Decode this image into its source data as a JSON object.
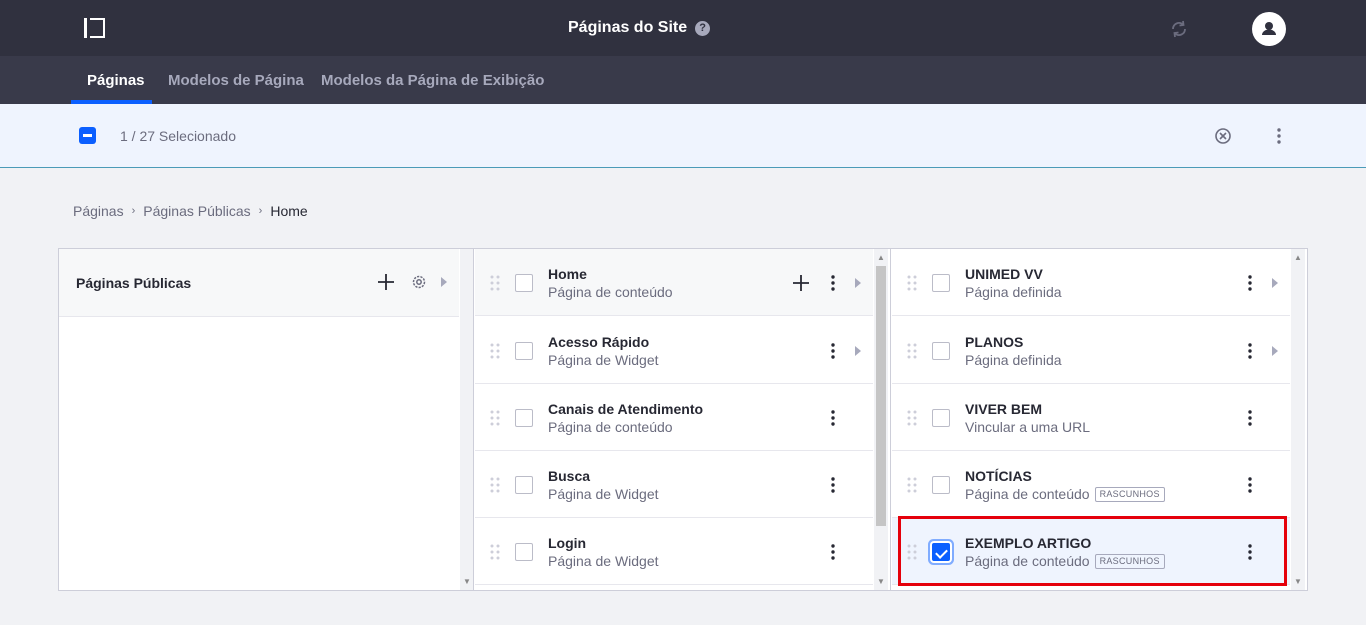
{
  "header": {
    "title": "Páginas do Site",
    "help_icon": "?"
  },
  "tabs": [
    {
      "label": "Páginas",
      "active": true
    },
    {
      "label": "Modelos de Página",
      "active": false
    },
    {
      "label": "Modelos da Página de Exibição",
      "active": false
    }
  ],
  "management_bar": {
    "selection_text": "1 / 27 Selecionado"
  },
  "breadcrumb": [
    "Páginas",
    "Páginas Públicas",
    "Home"
  ],
  "column1": {
    "title": "Páginas Públicas"
  },
  "column2": {
    "rows": [
      {
        "title": "Home",
        "subtitle": "Página de conteúdo"
      },
      {
        "title": "Acesso Rápido",
        "subtitle": "Página de Widget"
      },
      {
        "title": "Canais de Atendimento",
        "subtitle": "Página de conteúdo"
      },
      {
        "title": "Busca",
        "subtitle": "Página de Widget"
      },
      {
        "title": "Login",
        "subtitle": "Página de Widget"
      }
    ]
  },
  "column3": {
    "rows": [
      {
        "title": "UNIMED VV",
        "subtitle": "Página definida"
      },
      {
        "title": "PLANOS",
        "subtitle": "Página definida"
      },
      {
        "title": "VIVER BEM",
        "subtitle": "Vincular a uma URL"
      },
      {
        "title": "NOTÍCIAS",
        "subtitle": "Página de conteúdo",
        "badge": "RASCUNHOS"
      },
      {
        "title": "EXEMPLO ARTIGO",
        "subtitle": "Página de conteúdo",
        "badge": "RASCUNHOS",
        "checked": true
      }
    ]
  },
  "colors": {
    "topbar": "#30313f",
    "navbar": "#393a4a",
    "accent": "#0b5fff",
    "highlight_frame": "#e5000b"
  }
}
